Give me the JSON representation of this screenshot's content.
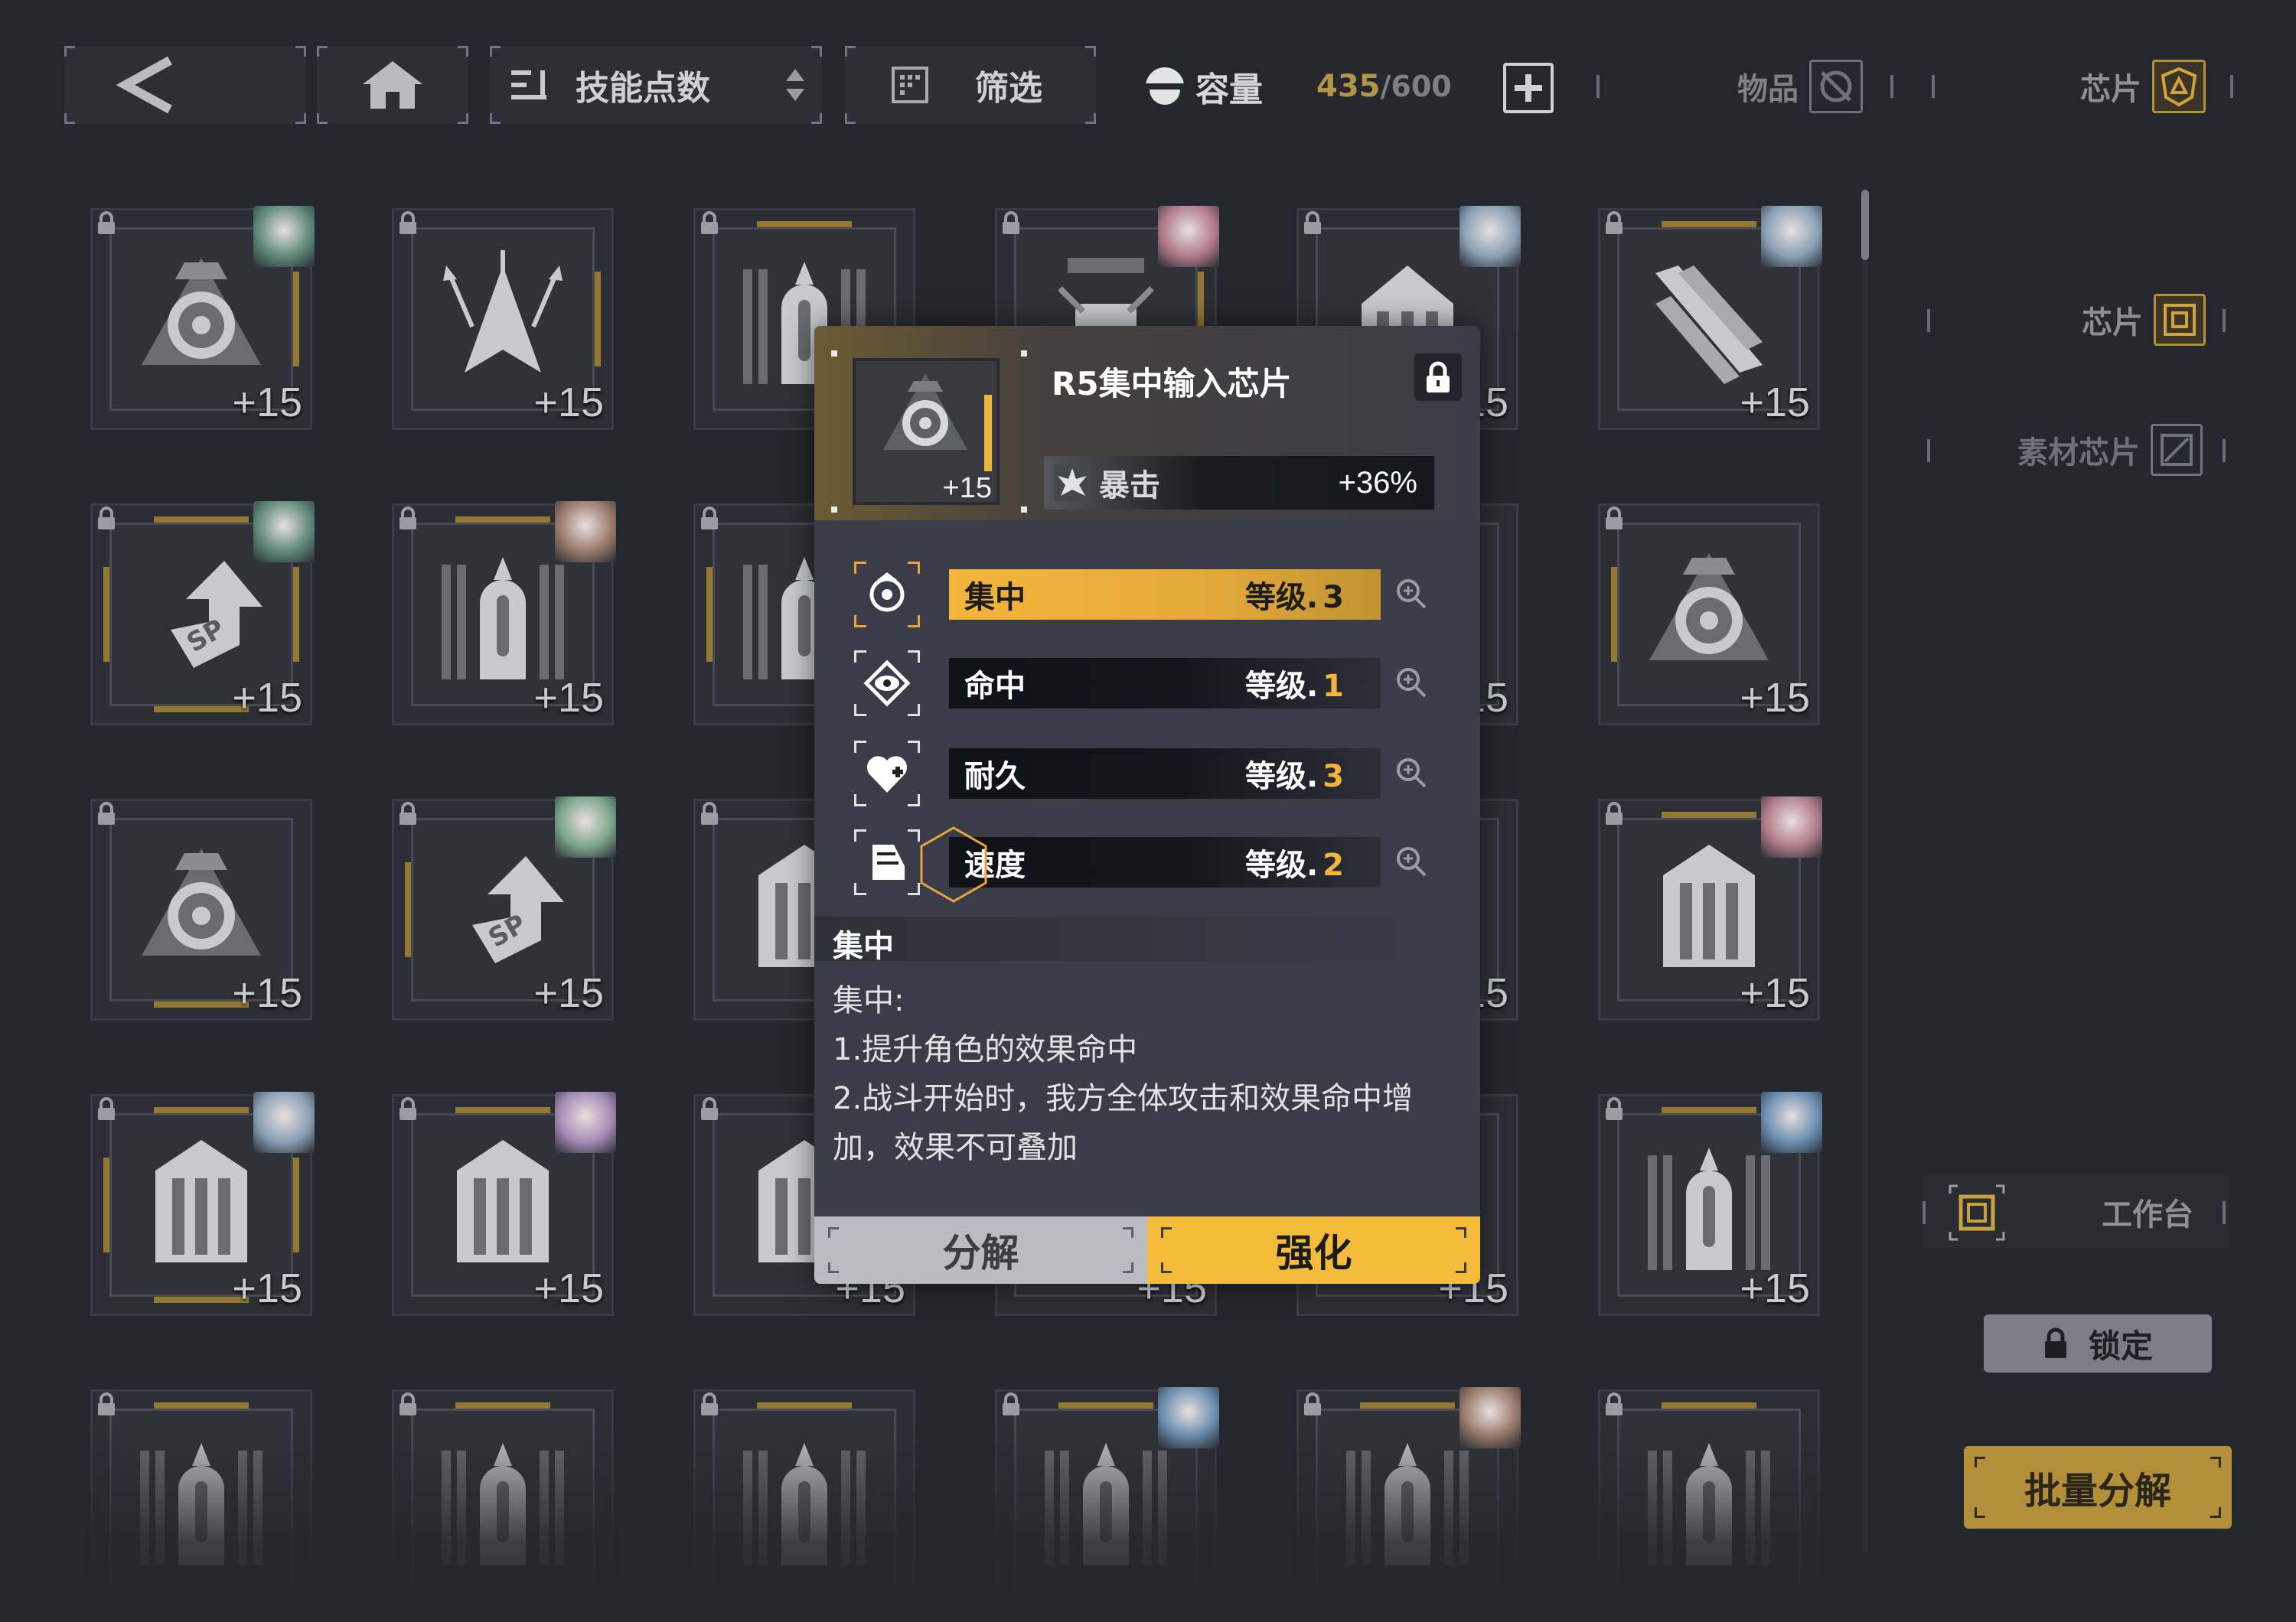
{
  "topbar": {
    "back_label": "<",
    "sort_label": "技能点数",
    "filter_label": "筛选",
    "capacity_label": "容量",
    "capacity_used": "435",
    "capacity_total": "/600",
    "tab_items_label": "物品",
    "tab_chips_label": "芯片"
  },
  "right_panel": {
    "chips_label": "芯片",
    "material_chips_label": "素材芯片",
    "workbench_label": "工作台",
    "lock_label": "锁定",
    "batch_decompose_label": "批量分解"
  },
  "grid": {
    "level_text": "+15",
    "rows": [
      [
        "target",
        "arrows",
        "tower",
        "fist",
        "house",
        "claw"
      ],
      [
        "sp",
        "tower",
        "tower",
        "",
        "",
        "target"
      ],
      [
        "target",
        "sp",
        "pillars",
        "",
        "",
        "pillars"
      ],
      [
        "pillars",
        "pillars",
        "pillars",
        "",
        "",
        "tower"
      ],
      [
        "tower",
        "tower",
        "tower",
        "tower",
        "tower",
        "tower"
      ]
    ]
  },
  "popup": {
    "chip_name": "R5集中输入芯片",
    "chip_level": "+15",
    "main_stat_name": "暴击",
    "main_stat_value": "+36%",
    "substats": [
      {
        "name": "集中",
        "level_label": "等级.",
        "level": "3",
        "active": true,
        "icon": "target-icon"
      },
      {
        "name": "命中",
        "level_label": "等级.",
        "level": "1",
        "active": false,
        "icon": "eye-icon"
      },
      {
        "name": "耐久",
        "level_label": "等级.",
        "level": "3",
        "active": false,
        "icon": "heart-icon"
      },
      {
        "name": "速度",
        "level_label": "等级.",
        "level": "2",
        "active": false,
        "icon": "boot-icon"
      }
    ],
    "desc_title": "集中",
    "desc_lines": [
      "集中:",
      "1.提升角色的效果命中",
      "2.战斗开始时，我方全体攻击和效果命中增",
      "加，效果不可叠加"
    ],
    "decompose_label": "分解",
    "enhance_label": "强化"
  },
  "colors": {
    "accent": "#f5bc3b",
    "background": "#25272e",
    "tile": "#2c2e35"
  }
}
